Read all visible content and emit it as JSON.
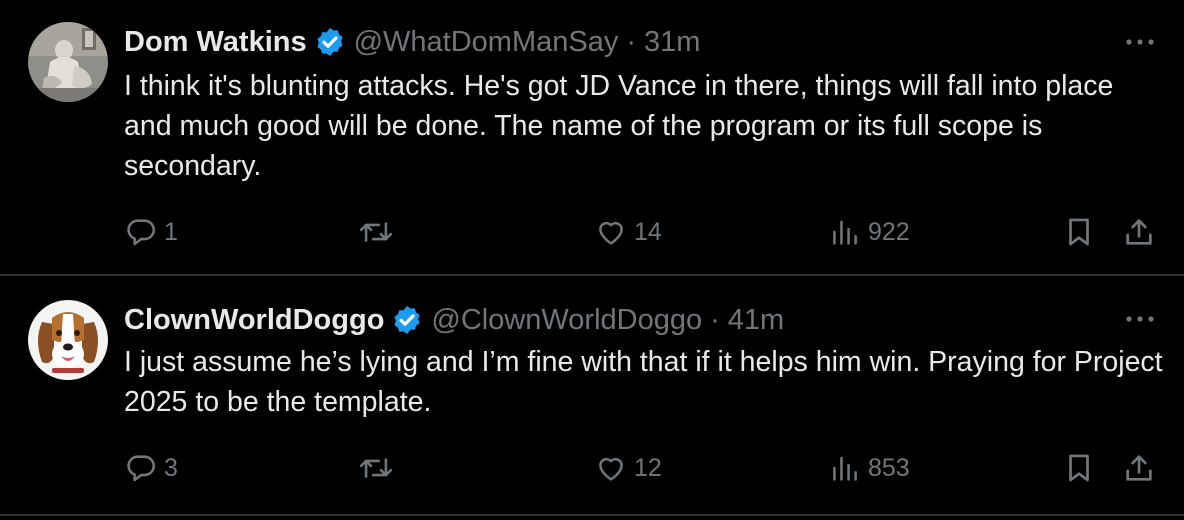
{
  "tweets": [
    {
      "author": {
        "name": "Dom Watkins",
        "handle": "@WhatDomManSay",
        "verified": true,
        "avatar": "statue-photo"
      },
      "separator": "·",
      "time": "31m",
      "text": "I think it's blunting attacks. He's got JD Vance in there, things will fall into place and much good will be done. The name of the program or its full scope is secondary.",
      "stats": {
        "replies": "1",
        "retweets": "",
        "likes": "14",
        "views": "922"
      }
    },
    {
      "author": {
        "name": "ClownWorldDoggo",
        "handle": "@ClownWorldDoggo",
        "verified": true,
        "avatar": "beagle-dog-photo"
      },
      "separator": "·",
      "time": "41m",
      "text": "I just assume he’s lying and I’m fine with that if it helps him win. Praying for Project 2025 to be the template.",
      "stats": {
        "replies": "3",
        "retweets": "",
        "likes": "12",
        "views": "853"
      }
    }
  ],
  "icons": {
    "verified": "verified-badge-icon",
    "more": "more-dots-icon",
    "reply": "reply-bubble-icon",
    "retweet": "retweet-icon",
    "like": "heart-icon",
    "views": "views-bars-icon",
    "bookmark": "bookmark-icon",
    "share": "share-upload-icon"
  },
  "colors": {
    "background": "#000000",
    "primary_text": "#e7e9ea",
    "secondary_text": "#71767b",
    "verified_blue": "#1d9bf0",
    "divider": "#2f3336"
  }
}
